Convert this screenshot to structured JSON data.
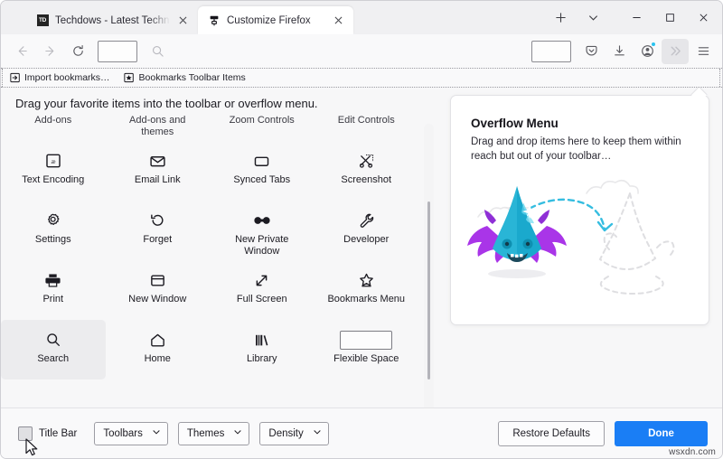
{
  "window": {
    "controls": [
      {
        "name": "minimize",
        "glyph": "minimize-icon"
      },
      {
        "name": "maximize",
        "glyph": "maximize-icon"
      },
      {
        "name": "close",
        "glyph": "close-icon"
      }
    ]
  },
  "tabs": [
    {
      "title": "Techdows - Latest Technology N",
      "favicon": "td-favicon",
      "active": false
    },
    {
      "title": "Customize Firefox",
      "favicon": "paint-roller-icon",
      "active": true
    }
  ],
  "tabstrip": {
    "new_tab_label": "+",
    "new_tab_icon": "plus-icon",
    "list_tabs_icon": "chevron-down-icon"
  },
  "navbar": {
    "back_icon": "back-arrow-icon",
    "forward_icon": "forward-arrow-icon",
    "reload_icon": "reload-icon",
    "flexible_space_icon": "flexible-space-placeholder",
    "search_icon": "search-icon",
    "right_icons": [
      "flexible-space-placeholder",
      "pocket-icon",
      "downloads-icon",
      "account-icon",
      "overflow-icon",
      "hamburger-menu-icon"
    ]
  },
  "bookmarks_toolbar": {
    "items": [
      {
        "label": "Import bookmarks…",
        "icon": "import-bookmarks-icon"
      },
      {
        "label": "Bookmarks Toolbar Items",
        "icon": "bookmarks-toolbar-items-icon"
      }
    ]
  },
  "customize": {
    "headline": "Drag your favorite items into the toolbar or overflow menu.",
    "palette": [
      {
        "label": "",
        "icon": "clipped-row-item",
        "clipped": true
      },
      {
        "label": "themes",
        "icon": "clipped-row-item",
        "clipped": true
      },
      {
        "label": "",
        "icon": "clipped-row-item",
        "clipped": true
      },
      {
        "label": "",
        "icon": "clipped-row-item",
        "clipped": true
      },
      {
        "label": "Text Encoding",
        "icon": "text-encoding-icon"
      },
      {
        "label": "Email Link",
        "icon": "email-link-icon"
      },
      {
        "label": "Synced Tabs",
        "icon": "synced-tabs-icon"
      },
      {
        "label": "Screenshot",
        "icon": "screenshot-icon"
      },
      {
        "label": "Settings",
        "icon": "settings-gear-icon"
      },
      {
        "label": "Forget",
        "icon": "forget-history-icon"
      },
      {
        "label": "New Private Window",
        "icon": "private-window-mask-icon"
      },
      {
        "label": "Developer",
        "icon": "developer-wrench-icon"
      },
      {
        "label": "Print",
        "icon": "print-icon"
      },
      {
        "label": "New Window",
        "icon": "new-window-icon"
      },
      {
        "label": "Full Screen",
        "icon": "full-screen-icon"
      },
      {
        "label": "Bookmarks Menu",
        "icon": "bookmarks-menu-star-icon"
      },
      {
        "label": "Search",
        "icon": "search-icon",
        "hover": true
      },
      {
        "label": "Home",
        "icon": "home-icon"
      },
      {
        "label": "Library",
        "icon": "library-icon"
      },
      {
        "label": "Flexible Space",
        "icon": "flexible-space-rect"
      }
    ]
  },
  "overflow_panel": {
    "title": "Overflow Menu",
    "description": "Drag and drop items here to keep them within reach but out of your toolbar…",
    "illustration": "firefox-creature-drag-illustration"
  },
  "footer": {
    "title_bar": {
      "label": "Title Bar",
      "checked": false
    },
    "dropdowns": [
      {
        "label": "Toolbars",
        "name": "toolbars-dropdown"
      },
      {
        "label": "Themes",
        "name": "themes-dropdown"
      },
      {
        "label": "Density",
        "name": "density-dropdown"
      }
    ],
    "restore_defaults_label": "Restore Defaults",
    "done_label": "Done"
  },
  "watermark": "wsxdn.com",
  "colors": {
    "accent_blue": "#1a7ef5",
    "badge_cyan": "#2ac3ef",
    "creature_teal": "#29b5d6",
    "creature_purple": "#a935e8",
    "content_bg": "#f7f7f8",
    "chrome_bg": "#f9f9fa"
  }
}
